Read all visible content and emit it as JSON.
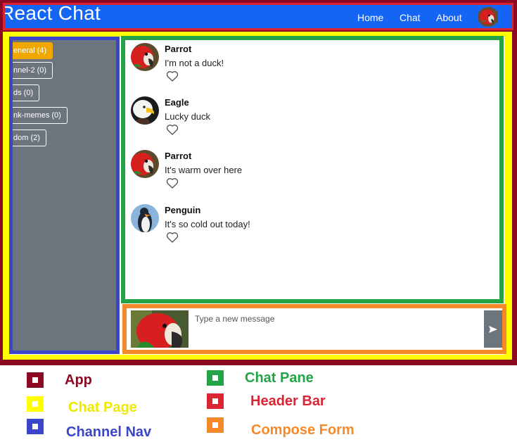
{
  "header": {
    "title": "React Chat",
    "nav": [
      "Home",
      "Chat",
      "About"
    ]
  },
  "channels": [
    {
      "label": "eneral (4)",
      "active": true
    },
    {
      "label": "nnel-2 (0)",
      "active": false
    },
    {
      "label": "ds (0)",
      "active": false
    },
    {
      "label": "nk-memes (0)",
      "active": false
    },
    {
      "label": "dom (2)",
      "active": false
    }
  ],
  "messages": [
    {
      "author": "Parrot",
      "text": "I'm not a duck!",
      "avatar": "parrot-icon"
    },
    {
      "author": "Eagle",
      "text": "Lucky duck",
      "avatar": "eagle-icon"
    },
    {
      "author": "Parrot",
      "text": "It's warm over here",
      "avatar": "parrot-icon"
    },
    {
      "author": "Penguin",
      "text": "It's so cold out today!",
      "avatar": "penguin-icon"
    }
  ],
  "compose": {
    "placeholder": "Type a new message",
    "send_icon": "send-icon"
  },
  "legend": [
    {
      "label": "App",
      "color": "#8b0a22"
    },
    {
      "label": "Chat Page",
      "color": "#ffff00"
    },
    {
      "label": "Channel Nav",
      "color": "#3a45c9"
    },
    {
      "label": "Chat Pane",
      "color": "#22a447"
    },
    {
      "label": "Header Bar",
      "color": "#dc2533"
    },
    {
      "label": "Compose Form",
      "color": "#f58a2a"
    }
  ],
  "colors": {
    "app": "#8b0a22",
    "header_bar": "#dc2533",
    "navbar": "#1565f5",
    "chat_page": "#ffff00",
    "channel_nav": "#3a45c9",
    "chat_pane": "#22a447",
    "compose_form": "#f58a2a",
    "active_channel": "#f0a800",
    "sidebar_bg": "#6c757d"
  }
}
